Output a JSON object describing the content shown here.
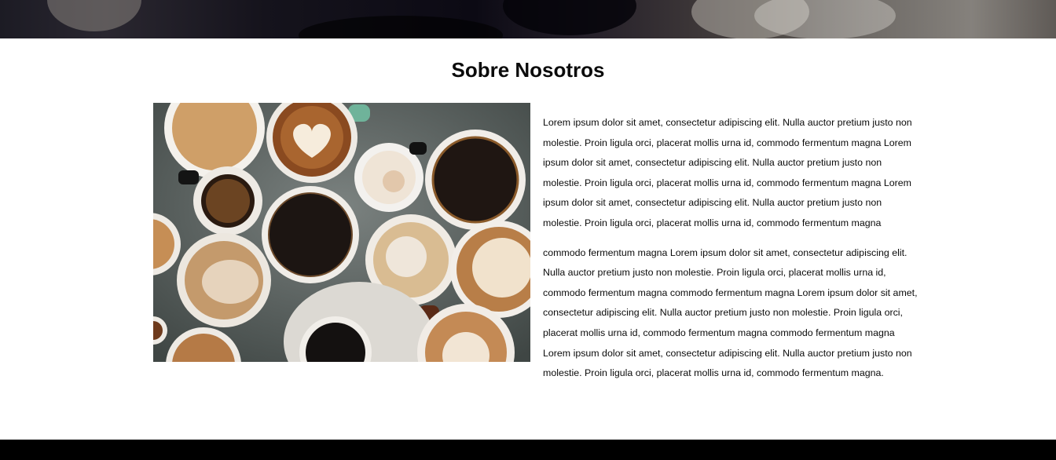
{
  "about": {
    "title": "Sobre Nosotros",
    "paragraph_1": "Lorem ipsum dolor sit amet, consectetur adipiscing elit. Nulla auctor pretium justo non molestie. Proin ligula orci, placerat mollis urna id, commodo fermentum magna Lorem ipsum dolor sit amet, consectetur adipiscing elit. Nulla auctor pretium justo non molestie. Proin ligula orci, placerat mollis urna id, commodo fermentum magna Lorem ipsum dolor sit amet, consectetur adipiscing elit. Nulla auctor pretium justo non molestie. Proin ligula orci, placerat mollis urna id, commodo fermentum magna",
    "paragraph_2": "commodo fermentum magna Lorem ipsum dolor sit amet, consectetur adipiscing elit. Nulla auctor pretium justo non molestie. Proin ligula orci, placerat mollis urna id, commodo fermentum magna commodo fermentum magna Lorem ipsum dolor sit amet, consectetur adipiscing elit. Nulla auctor pretium justo non molestie. Proin ligula orci, placerat mollis urna id, commodo fermentum magna commodo fermentum magna Lorem ipsum dolor sit amet, consectetur adipiscing elit. Nulla auctor pretium justo non molestie. Proin ligula orci, placerat mollis urna id, commodo fermentum magna."
  },
  "colors": {
    "page_background": "#ffffff",
    "text": "#0b0b0b",
    "footer": "#000000",
    "table_surface": "#5f6663"
  }
}
